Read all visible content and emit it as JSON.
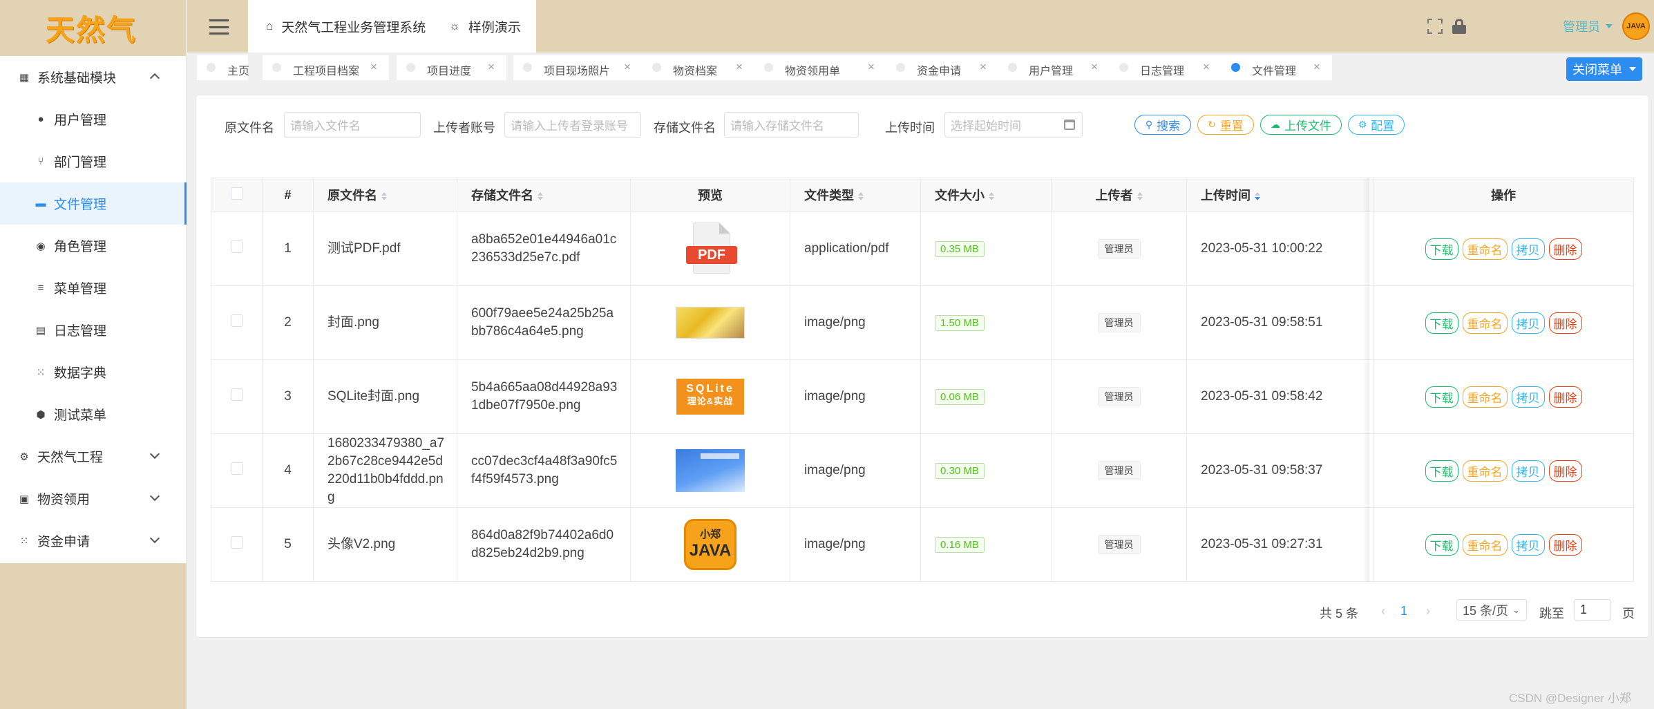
{
  "brand": {
    "logo_text": "天然气"
  },
  "sidebar": {
    "items": [
      {
        "label": "系统基础模块",
        "level": "top",
        "icon": "dashboard-icon",
        "state": "expanded"
      },
      {
        "label": "用户管理",
        "level": "sub",
        "icon": "user-icon"
      },
      {
        "label": "部门管理",
        "level": "sub",
        "icon": "branch-icon"
      },
      {
        "label": "文件管理",
        "level": "sub",
        "icon": "folder-icon",
        "active": true
      },
      {
        "label": "角色管理",
        "level": "sub",
        "icon": "users-icon"
      },
      {
        "label": "菜单管理",
        "level": "sub",
        "icon": "list-icon"
      },
      {
        "label": "日志管理",
        "level": "sub",
        "icon": "log-icon"
      },
      {
        "label": "数据字典",
        "level": "sub",
        "icon": "grid-icon"
      },
      {
        "label": "测试菜单",
        "level": "sub",
        "icon": "bug-icon"
      },
      {
        "label": "天然气工程",
        "level": "top",
        "icon": "gear-icon",
        "state": "collapsed"
      },
      {
        "label": "物资领用",
        "level": "top",
        "icon": "box-icon",
        "state": "collapsed"
      },
      {
        "label": "资金申请",
        "level": "top",
        "icon": "apps-icon",
        "state": "collapsed"
      }
    ]
  },
  "header": {
    "tabs": [
      {
        "label": "天然气工程业务管理系统",
        "icon": "home-icon"
      },
      {
        "label": "样例演示",
        "icon": "bulb-icon"
      }
    ],
    "user_name": "管理员",
    "avatar_text": "JAVA"
  },
  "page_tabs": [
    {
      "label": "主页",
      "closable": false
    },
    {
      "label": "工程项目档案",
      "closable": true
    },
    {
      "label": "项目进度",
      "closable": true
    },
    {
      "label": "项目现场照片",
      "closable": true
    },
    {
      "label": "物资档案",
      "closable": true
    },
    {
      "label": "物资领用单",
      "closable": true
    },
    {
      "label": "资金申请",
      "closable": true
    },
    {
      "label": "用户管理",
      "closable": true
    },
    {
      "label": "日志管理",
      "closable": true
    },
    {
      "label": "文件管理",
      "closable": true,
      "active": true
    }
  ],
  "close_menu_label": "关闭菜单",
  "filters": {
    "orig_name": {
      "label": "原文件名",
      "placeholder": "请输入文件名"
    },
    "uploader": {
      "label": "上传者账号",
      "placeholder": "请输入上传者登录账号"
    },
    "store_name": {
      "label": "存储文件名",
      "placeholder": "请输入存储文件名"
    },
    "upload_time": {
      "label": "上传时间",
      "placeholder": "选择起始时间"
    }
  },
  "actions": {
    "search": "搜索",
    "reset": "重置",
    "upload": "上传文件",
    "config": "配置"
  },
  "table": {
    "columns": {
      "index": "#",
      "orig_name": "原文件名",
      "store_name": "存储文件名",
      "preview": "预览",
      "type": "文件类型",
      "size": "文件大小",
      "uploader": "上传者",
      "time": "上传时间",
      "ops": "操作"
    },
    "row_ops": {
      "download": "下载",
      "rename": "重命名",
      "copy": "拷贝",
      "delete": "删除"
    },
    "rows": [
      {
        "index": "1",
        "orig_name": "测试PDF.pdf",
        "store_name": "a8ba652e01e44946a01c236533d25e7c.pdf",
        "preview": "pdf",
        "preview_text": "PDF",
        "type": "application/pdf",
        "size": "0.35 MB",
        "uploader": "管理员",
        "time": "2023-05-31 10:00:22"
      },
      {
        "index": "2",
        "orig_name": "封面.png",
        "store_name": "600f79aee5e24a25b25abb786c4a64e5.png",
        "preview": "food",
        "type": "image/png",
        "size": "1.50 MB",
        "uploader": "管理员",
        "time": "2023-05-31 09:58:51"
      },
      {
        "index": "3",
        "orig_name": "SQLite封面.png",
        "store_name": "5b4a665aa08d44928a931dbe07f7950e.png",
        "preview": "sqlite",
        "preview_text": "SQLite",
        "preview_sub": "理论&实战",
        "type": "image/png",
        "size": "0.06 MB",
        "uploader": "管理员",
        "time": "2023-05-31 09:58:42"
      },
      {
        "index": "4",
        "orig_name": "1680233479380_a72b67c28ce9442e5d220d11b0b4fddd.png",
        "store_name": "cc07dec3cf4a48f3a90fc5f4f59f4573.png",
        "preview": "banner",
        "type": "image/png",
        "size": "0.30 MB",
        "uploader": "管理员",
        "time": "2023-05-31 09:58:37"
      },
      {
        "index": "5",
        "orig_name": "头像V2.png",
        "store_name": "864d0a82f9b74402a6d0d825eb24d2b9.png",
        "preview": "java",
        "preview_text": "JAVA",
        "preview_sub": "小郑",
        "type": "image/png",
        "size": "0.16 MB",
        "uploader": "管理员",
        "time": "2023-05-31 09:27:31"
      }
    ]
  },
  "pagination": {
    "total": "共 5 条",
    "current_page": "1",
    "page_size": "15 条/页",
    "jump_label": "跳至",
    "jump_value": "1",
    "page_unit": "页"
  },
  "watermark": "CSDN @Designer 小郑"
}
